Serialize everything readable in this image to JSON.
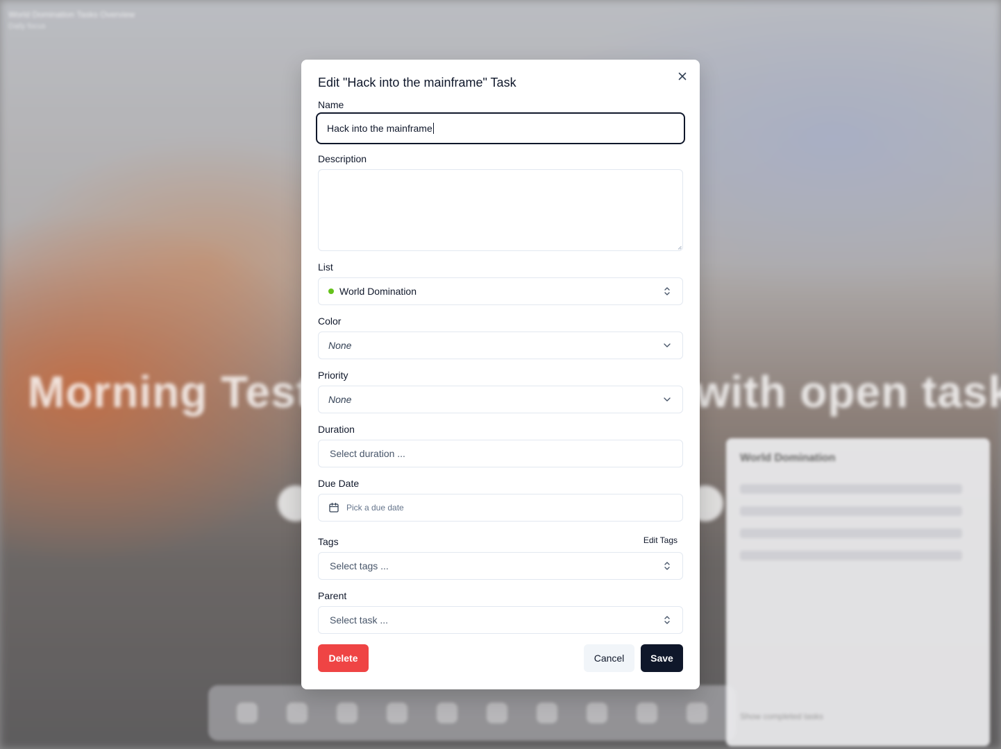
{
  "background": {
    "header_title": "World Domination Tasks Overview",
    "header_subtitle": "Daily focus",
    "headline": "Morning Tester, start your day with open tasks",
    "panel_title": "World Domination",
    "panel_footer": "Show completed tasks"
  },
  "modal": {
    "title": "Edit \"Hack into the mainframe\" Task",
    "close_icon": "close-icon",
    "name_label": "Name",
    "name_value": "Hack into the mainframe",
    "description_label": "Description",
    "description_value": "",
    "list_label": "List",
    "list_value": "World Domination",
    "list_color": "#65c21b",
    "color_label": "Color",
    "color_value": "None",
    "priority_label": "Priority",
    "priority_value": "None",
    "duration_label": "Duration",
    "duration_placeholder": "Select duration ...",
    "due_date_label": "Due Date",
    "due_date_placeholder": "Pick a due date",
    "tags_label": "Tags",
    "edit_tags_label": "Edit Tags",
    "tags_placeholder": "Select tags ...",
    "parent_label": "Parent",
    "parent_placeholder": "Select task ...",
    "delete_label": "Delete",
    "cancel_label": "Cancel",
    "save_label": "Save"
  },
  "colors": {
    "primary": "#0f172a",
    "danger": "#ef4444",
    "secondary_bg": "#f1f5f9",
    "border": "#e2e8f0"
  }
}
